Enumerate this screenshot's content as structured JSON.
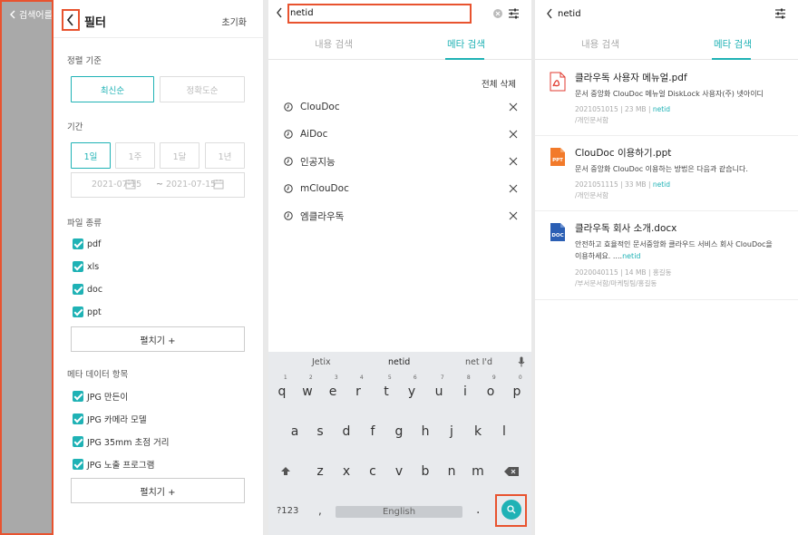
{
  "panel1": {
    "dim_back_label": "검색어를",
    "title": "필터",
    "reset": "초기화",
    "sort": {
      "label": "정렬 기준",
      "options": [
        "최신순",
        "정확도순"
      ],
      "selected": 0
    },
    "period": {
      "label": "기간",
      "options": [
        "1일",
        "1주",
        "1달",
        "1년"
      ],
      "selected": 0,
      "date_from": "2021-07-15",
      "date_sep": "~",
      "date_to": "2021-07-15"
    },
    "filetype": {
      "label": "파일 종류",
      "items": [
        "pdf",
        "xls",
        "doc",
        "ppt"
      ],
      "expand": "펼치기 +"
    },
    "meta": {
      "label": "메타 데이터 항목",
      "items": [
        "JPG 만든이",
        "JPG 카메라 모델",
        "JPG 35mm 초점 거리",
        "JPG 노출 프로그램"
      ],
      "expand": "펼치기 +"
    }
  },
  "panel2": {
    "search_value": "netid",
    "tabs": [
      "내용 검색",
      "메타 검색"
    ],
    "active_tab": 1,
    "clear_all": "전체 삭제",
    "history": [
      "ClouDoc",
      "AiDoc",
      "인공지능",
      "mClouDoc",
      "엠클라우독"
    ],
    "keyboard": {
      "suggestions": [
        "Jetix",
        "netid",
        "net I'd"
      ],
      "row1": [
        "q",
        "w",
        "e",
        "r",
        "t",
        "y",
        "u",
        "i",
        "o",
        "p"
      ],
      "row1_nums": [
        "1",
        "2",
        "3",
        "4",
        "5",
        "6",
        "7",
        "8",
        "9",
        "0"
      ],
      "row2": [
        "a",
        "s",
        "d",
        "f",
        "g",
        "h",
        "j",
        "k",
        "l"
      ],
      "row3": [
        "z",
        "x",
        "c",
        "v",
        "b",
        "n",
        "m"
      ],
      "sym": "?123",
      "comma": ",",
      "space": "English",
      "period": "."
    }
  },
  "panel3": {
    "query": "netid",
    "tabs": [
      "내용 검색",
      "메타 검색"
    ],
    "active_tab": 1,
    "results": [
      {
        "icon": "pdf-file-icon",
        "icon_label": "PDF",
        "title": "클라우독 사용자 메뉴얼.pdf",
        "desc": "문서 중앙화 ClouDoc 메뉴얼 DiskLock 사용자(주) 넷아이디",
        "meta_prefix": "2021051015 | 23 MB | ",
        "meta_hl": "netid",
        "path": "/개인문서함"
      },
      {
        "icon": "ppt-file-icon",
        "icon_label": "PPT",
        "title": "ClouDoc 이용하기.ppt",
        "desc": "문서 중앙화 ClouDoc 이용하는 방법은 다음과 같습니다.",
        "meta_prefix": "2021051115 | 33 MB | ",
        "meta_hl": "netid",
        "path": "/개인문서함"
      },
      {
        "icon": "doc-file-icon",
        "icon_label": "DOC",
        "title": "클라우독 회사 소개.docx",
        "desc_line1": "안전하고 효율적인 문서중앙화 클라우드 서비스 회사 ClouDoc을",
        "desc_line2_prefix": "이용하세요. ....",
        "desc_line2_hl": "netid",
        "meta": "2020040115 | 14 MB | 홍길동",
        "path": "/부서문서함/마케팅팀/홍길동"
      }
    ]
  },
  "colors": {
    "accent": "#1fb2b5",
    "highlight": "#e8532f",
    "dim": "#a9a9a9"
  }
}
